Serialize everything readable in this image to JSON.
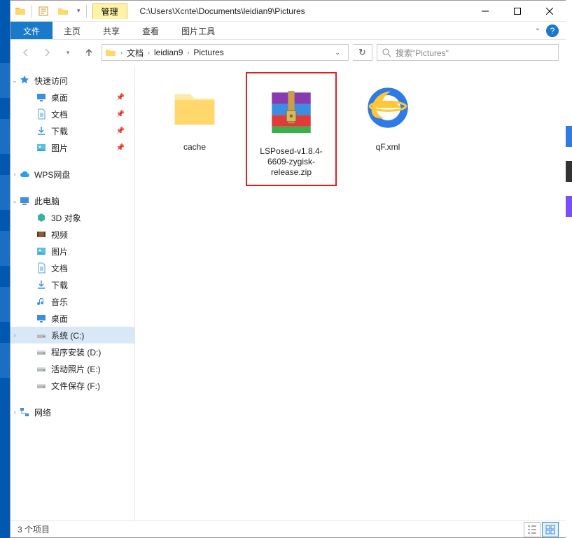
{
  "title_path": "C:\\Users\\Xcnte\\Documents\\leidian9\\Pictures",
  "tool_tab_top": "管理",
  "tool_tab_bottom": "图片工具",
  "ribbon": {
    "file": "文件",
    "home": "主页",
    "share": "共享",
    "view": "查看"
  },
  "breadcrumbs": [
    "文档",
    "leidian9",
    "Pictures"
  ],
  "search_placeholder": "搜索\"Pictures\"",
  "sidebar": {
    "quick_access": "快速访问",
    "quick_items": [
      {
        "label": "桌面",
        "icon": "desktop"
      },
      {
        "label": "文档",
        "icon": "doc"
      },
      {
        "label": "下载",
        "icon": "download"
      },
      {
        "label": "图片",
        "icon": "picture"
      }
    ],
    "wps": "WPS网盘",
    "this_pc": "此电脑",
    "pc_items": [
      {
        "label": "3D 对象",
        "icon": "3d"
      },
      {
        "label": "视频",
        "icon": "video"
      },
      {
        "label": "图片",
        "icon": "picture"
      },
      {
        "label": "文档",
        "icon": "doc"
      },
      {
        "label": "下载",
        "icon": "download"
      },
      {
        "label": "音乐",
        "icon": "music"
      },
      {
        "label": "桌面",
        "icon": "desktop"
      },
      {
        "label": "系统 (C:)",
        "icon": "drive",
        "selected": true
      },
      {
        "label": "程序安装 (D:)",
        "icon": "drive"
      },
      {
        "label": "活动照片 (E:)",
        "icon": "drive"
      },
      {
        "label": "文件保存 (F:)",
        "icon": "drive"
      }
    ],
    "network": "网络"
  },
  "files": [
    {
      "name": "cache",
      "type": "folder"
    },
    {
      "name": "LSPosed-v1.8.4-6609-zygisk-release.zip",
      "type": "archive",
      "highlighted": true
    },
    {
      "name": "qF.xml",
      "type": "ie"
    }
  ],
  "status": "3 个项目"
}
